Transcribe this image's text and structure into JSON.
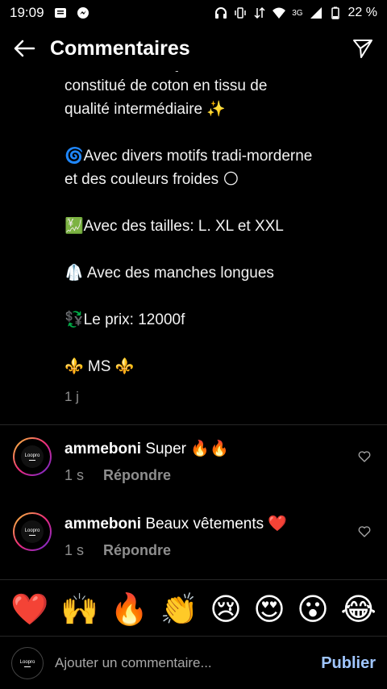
{
  "status_bar": {
    "time": "19:09",
    "battery": "22 %",
    "network": "3G"
  },
  "header": {
    "title": "Commentaires"
  },
  "caption": {
    "cut_line": "COMPLET TUNIQUE",
    "line1": "constitué de coton en tissu de",
    "line2": "qualité intermédiaire ✨",
    "line3": "🌀Avec divers motifs tradi-morderne",
    "line4": "et des couleurs froides 🌕",
    "line5": "💹Avec des tailles: L. XL et  XXL",
    "line6": "🥼 Avec des manches longues",
    "line7": "💱Le prix: 12000f",
    "line8": "⚜️ MS ⚜️",
    "time": "1 j"
  },
  "comments": [
    {
      "user": "ammeboni",
      "text": "Super 🔥🔥",
      "time": "1 s",
      "reply": "Répondre"
    },
    {
      "user": "ammeboni",
      "text": "Beaux vêtements ❤️",
      "time": "1 s",
      "reply": "Répondre"
    }
  ],
  "avatar_text": "Loopro",
  "emojis": [
    "❤️",
    "🙌",
    "🔥",
    "👏",
    "😢",
    "😍",
    "😮",
    "😂"
  ],
  "input": {
    "placeholder": "Ajouter un commentaire...",
    "publish": "Publier"
  }
}
